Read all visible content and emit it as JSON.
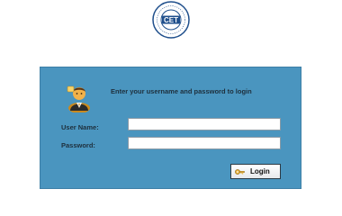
{
  "logo": {
    "text": "CET",
    "ring_text": "COMMON ENTRANCE TEST"
  },
  "login_panel": {
    "heading": "Enter your username and password to login",
    "username_label": "User Name:",
    "username_value": "",
    "password_label": "Password:",
    "password_value": "",
    "login_button_label": "Login"
  },
  "colors": {
    "panel_background": "#4a95bf",
    "logo_blue": "#1f4f8c"
  }
}
